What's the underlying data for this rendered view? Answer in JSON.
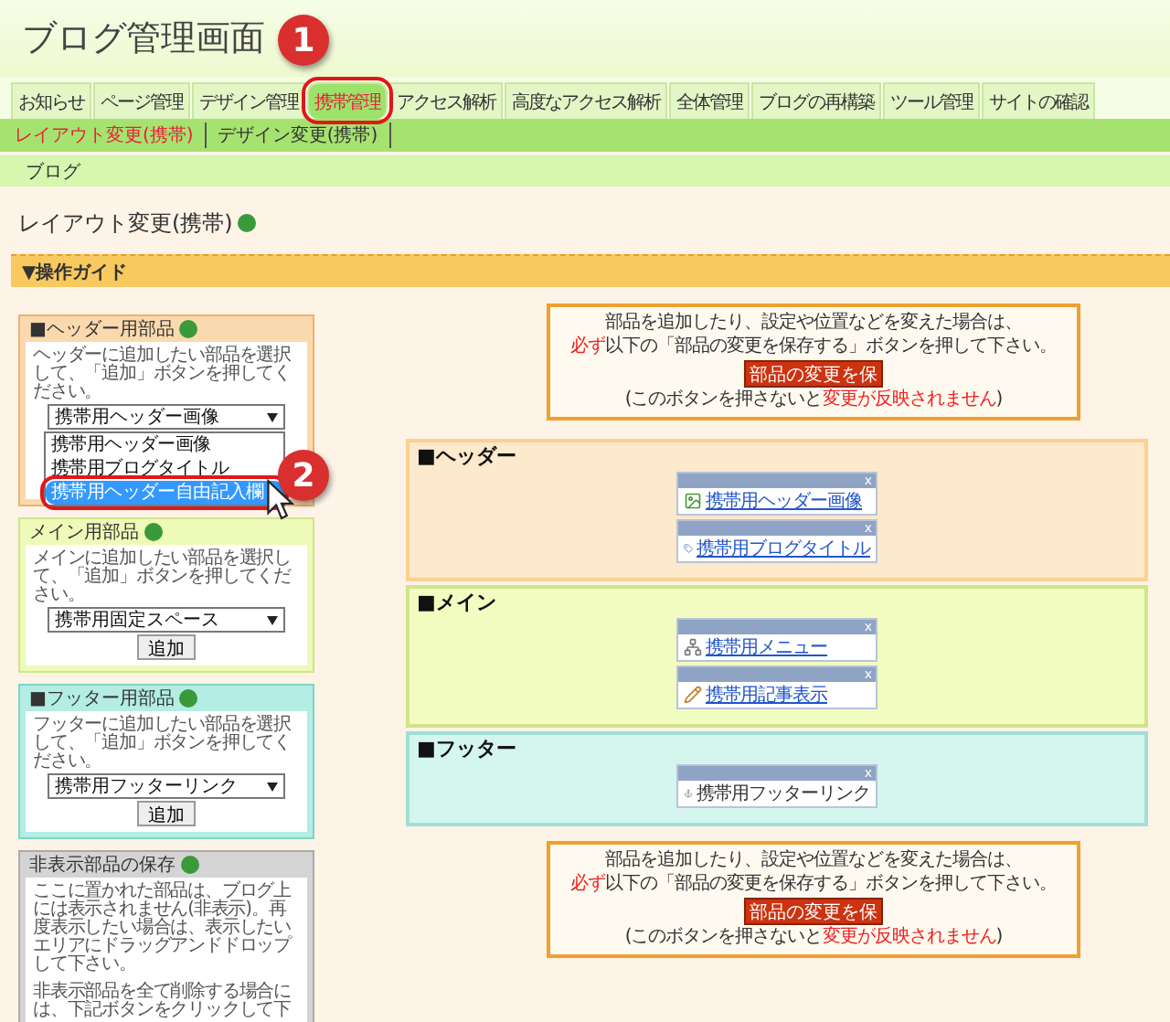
{
  "app_title": "ブログ管理画面",
  "nav_tabs": [
    {
      "label": "お知らせ",
      "selected": false
    },
    {
      "label": "ページ管理",
      "selected": false
    },
    {
      "label": "デザイン管理",
      "selected": false
    },
    {
      "label": "携帯管理",
      "selected": true
    },
    {
      "label": "アクセス解析",
      "selected": false
    },
    {
      "label": "高度なアクセス解析",
      "selected": false
    },
    {
      "label": "全体管理",
      "selected": false
    },
    {
      "label": "ブログの再構築",
      "selected": false
    },
    {
      "label": "ツール管理",
      "selected": false
    },
    {
      "label": "サイトの確認",
      "selected": false
    }
  ],
  "sub_nav": [
    {
      "label": "レイアウト変更(携帯)",
      "selected": true
    },
    {
      "label": "デザイン変更(携帯)",
      "selected": false
    }
  ],
  "breadcrumb": "ブログ",
  "page_title": "レイアウト変更(携帯)",
  "guide_bar": "▼操作ガイド",
  "parts_panels": [
    {
      "kind": "header",
      "title": "■ヘッダー用部品",
      "description": "ヘッダーに追加したい部品を選択して、「追加」ボタンを押してください。",
      "select_value": "携帯用ヘッダー画像",
      "open_options": [
        {
          "label": "携帯用ヘッダー画像",
          "selected": false
        },
        {
          "label": "携帯用ブログタイトル",
          "selected": false
        },
        {
          "label": "携帯用ヘッダー自由記入欄",
          "selected": true
        }
      ]
    },
    {
      "kind": "main",
      "title": "メイン用部品",
      "description": "メインに追加したい部品を選択して、「追加」ボタンを押してください。",
      "select_value": "携帯用固定スペース",
      "button": "追加"
    },
    {
      "kind": "footer",
      "title": "■フッター用部品",
      "description": "フッターに追加したい部品を選択して、「追加」ボタンを押してください。",
      "select_value": "携帯用フッターリンク",
      "button": "追加"
    },
    {
      "kind": "hidden",
      "title": "非表示部品の保存",
      "paragraphs": [
        "ここに置かれた部品は、ブログ上には表示されません(非表示)。再度表示したい場合は、表示したいエリアにドラッグアンドドロップして下さい。",
        "非表示部品を全て削除する場合には、下記ボタンをクリックして下"
      ]
    }
  ],
  "notices": [
    {
      "lines": [
        [
          {
            "text": "部品を追加したり、設定や位置などを変えた場合は、",
            "red": false
          }
        ],
        [
          {
            "text": "必ず",
            "red": true
          },
          {
            "text": "以下の「部品の変更を保存する」ボタンを押して下さい。",
            "red": false
          }
        ]
      ],
      "button": "部品の変更を保",
      "footnote": [
        {
          "text": "(このボタンを押さないと",
          "red": false
        },
        {
          "text": "変更が反映されません",
          "red": true
        },
        {
          "text": ")",
          "red": false
        }
      ]
    },
    {
      "lines": [
        [
          {
            "text": "部品を追加したり、設定や位置などを変えた場合は、",
            "red": false
          }
        ],
        [
          {
            "text": "必ず",
            "red": true
          },
          {
            "text": "以下の「部品の変更を保存する」ボタンを押して下さい。",
            "red": false
          }
        ]
      ],
      "button": "部品の変更を保",
      "footnote": [
        {
          "text": "(このボタンを押さないと",
          "red": false
        },
        {
          "text": "変更が反映されません",
          "red": true
        },
        {
          "text": ")",
          "red": false
        }
      ]
    }
  ],
  "zones": [
    {
      "kind": "header",
      "title": "■ヘッダー",
      "widgets": [
        {
          "kind": "image",
          "label": "携帯用ヘッダー画像",
          "link": true,
          "close": "x"
        },
        {
          "kind": "tag",
          "label": "携帯用ブログタイトル",
          "link": true,
          "close": "x"
        }
      ]
    },
    {
      "kind": "main",
      "title": "■メイン",
      "widgets": [
        {
          "kind": "menu",
          "label": "携帯用メニュー",
          "link": true,
          "close": "x"
        },
        {
          "kind": "article",
          "label": "携帯用記事表示",
          "link": true,
          "close": "x"
        }
      ]
    },
    {
      "kind": "footer",
      "title": "■フッター",
      "widgets": [
        {
          "kind": "anchor",
          "label": "携帯用フッターリンク",
          "link": false,
          "close": "x"
        }
      ]
    }
  ],
  "callouts": [
    "1",
    "2"
  ]
}
